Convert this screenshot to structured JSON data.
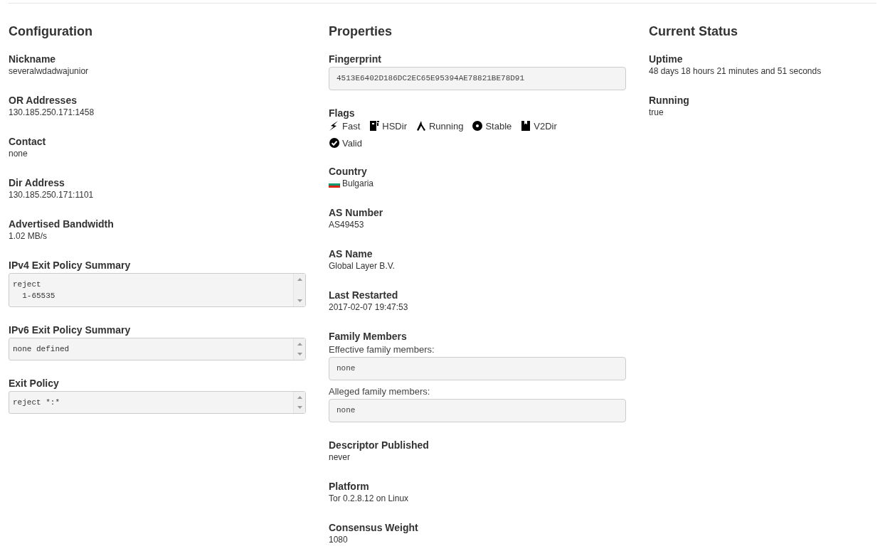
{
  "columns": [
    {
      "title": "Configuration",
      "fields": [
        {
          "kind": "text",
          "label": "Nickname",
          "value": "severalwdadwajunior"
        },
        {
          "kind": "text",
          "label": "OR Addresses",
          "value": "130.185.250.171:1458"
        },
        {
          "kind": "text",
          "label": "Contact",
          "value": "none"
        },
        {
          "kind": "text",
          "label": "Dir Address",
          "value": "130.185.250.171:1101"
        },
        {
          "kind": "text",
          "label": "Advertised Bandwidth",
          "value": "1.02 MB/s"
        },
        {
          "kind": "scrollbox",
          "label": "IPv4 Exit Policy Summary",
          "lines": [
            "reject",
            "  1-65535"
          ]
        },
        {
          "kind": "scrollbox",
          "label": "IPv6 Exit Policy Summary",
          "lines": [
            "none defined"
          ]
        },
        {
          "kind": "scrollbox",
          "label": "Exit Policy",
          "lines": [
            "reject *:*"
          ]
        }
      ]
    },
    {
      "title": "Properties",
      "fields": [
        {
          "kind": "box",
          "label": "Fingerprint",
          "value": "4513E6402D186DC2EC65E95394AE78821BE78D91"
        },
        {
          "kind": "flags",
          "label": "Flags",
          "flags": [
            "Fast",
            "HSDir",
            "Running",
            "Stable",
            "V2Dir",
            "Valid"
          ]
        },
        {
          "kind": "country",
          "label": "Country",
          "value": "Bulgaria"
        },
        {
          "kind": "text",
          "label": "AS Number",
          "value": "AS49453"
        },
        {
          "kind": "text",
          "label": "AS Name",
          "value": "Global Layer B.V."
        },
        {
          "kind": "text",
          "label": "Last Restarted",
          "value": "2017-02-07 19:47:53"
        },
        {
          "kind": "family",
          "label": "Family Members",
          "groups": [
            {
              "caption": "Effective family members:",
              "value": "none"
            },
            {
              "caption": "Alleged family members:",
              "value": "none"
            }
          ]
        },
        {
          "kind": "text",
          "label": "Descriptor Published",
          "value": "never"
        },
        {
          "kind": "text",
          "label": "Platform",
          "value": "Tor 0.2.8.12 on Linux"
        },
        {
          "kind": "text",
          "label": "Consensus Weight",
          "value": "1080"
        }
      ]
    },
    {
      "title": "Current Status",
      "fields": [
        {
          "kind": "text",
          "label": "Uptime",
          "value": "48 days 18 hours 21 minutes and 51 seconds"
        },
        {
          "kind": "text",
          "label": "Running",
          "value": "true"
        }
      ]
    }
  ]
}
